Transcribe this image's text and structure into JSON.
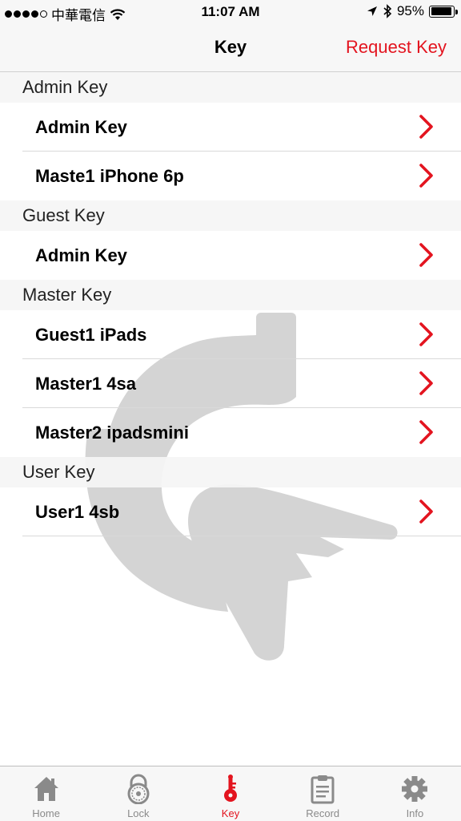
{
  "status_bar": {
    "carrier": "中華電信",
    "time": "11:07 AM",
    "battery": "95%",
    "battery_level": 0.95,
    "signal_bars": 4
  },
  "nav": {
    "title": "Key",
    "action_label": "Request Key"
  },
  "sections": [
    {
      "title": "Admin Key",
      "items": [
        "Admin Key",
        "Maste1 iPhone 6p"
      ]
    },
    {
      "title": "Guest Key",
      "items": [
        "Admin Key"
      ]
    },
    {
      "title": "Master Key",
      "items": [
        "Guest1 iPads",
        "Master1 4sa",
        "Master2 ipadsmini"
      ]
    },
    {
      "title": "User Key",
      "items": [
        "User1 4sb"
      ]
    }
  ],
  "tabs": [
    {
      "label": "Home",
      "icon": "home-icon",
      "active": false
    },
    {
      "label": "Lock",
      "icon": "lock-icon",
      "active": false
    },
    {
      "label": "Key",
      "icon": "key-icon",
      "active": true
    },
    {
      "label": "Record",
      "icon": "clipboard-icon",
      "active": false
    },
    {
      "label": "Info",
      "icon": "gear-icon",
      "active": false
    }
  ],
  "colors": {
    "accent": "#e3141f",
    "tab_inactive": "#8a8a8a",
    "bar_background": "#f7f7f7",
    "watermark": "#d6d6d6"
  }
}
